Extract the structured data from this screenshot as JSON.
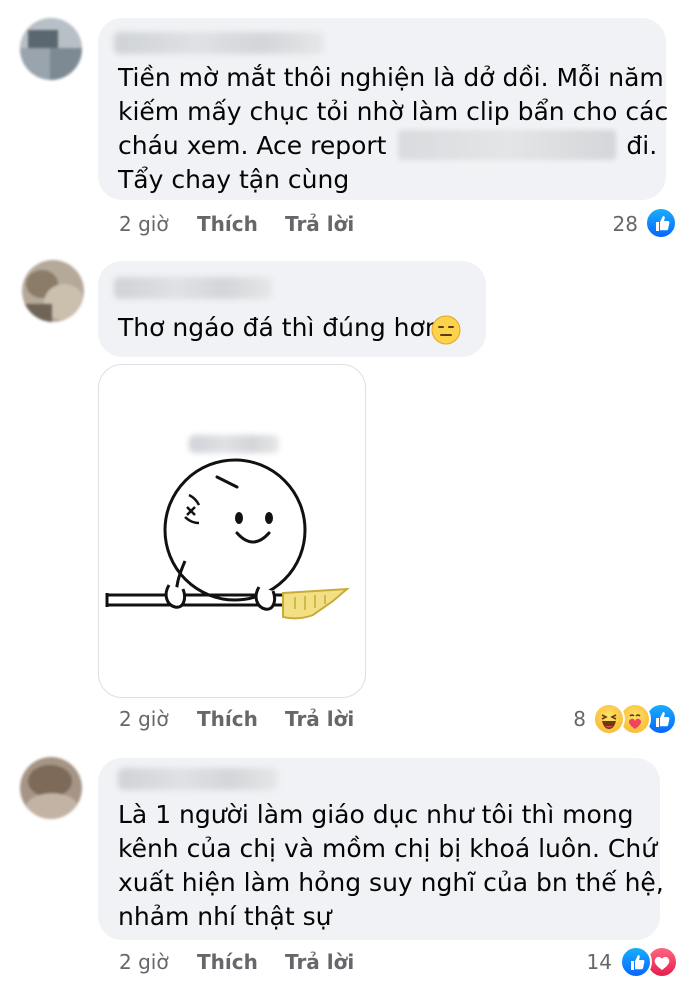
{
  "comments": [
    {
      "text_lines": [
        "Tiền mờ mắt thôi nghiện là dở dồi. Mỗi năm",
        "kiếm mấy chục tỏi nhờ làm clip bẩn cho các",
        "cháu xem. Ace report",
        "đi.",
        "Tẩy chay tận cùng"
      ],
      "time": "2 giờ",
      "like_label": "Thích",
      "reply_label": "Trả lời",
      "reaction_count": "28",
      "reactions": [
        "like-icon"
      ]
    },
    {
      "text_lines": [
        "Thơ ngáo đá thì đúng hơn"
      ],
      "emoji": "😑",
      "time": "2 giờ",
      "like_label": "Thích",
      "reply_label": "Trả lời",
      "reaction_count": "8",
      "reactions": [
        "haha-icon",
        "care-icon",
        "like-icon"
      ]
    },
    {
      "text_lines": [
        "Là 1 người làm giáo dục như tôi thì mong",
        "kênh của chị và mồm chị bị khoá luôn. Chứ",
        "xuất hiện làm hỏng suy nghĩ của bn thế hệ,",
        "nhảm nhí thật sự"
      ],
      "time": "2 giờ",
      "like_label": "Thích",
      "reply_label": "Trả lời",
      "reaction_count": "14",
      "reactions": [
        "like-icon",
        "heart-icon"
      ]
    }
  ],
  "colors": {
    "bubble": "#f0f2f5",
    "meta_text": "#65676b",
    "like_blue": "#0866ff",
    "heart_red": "#e61e4d",
    "sticker_gold": "#f3e085"
  }
}
